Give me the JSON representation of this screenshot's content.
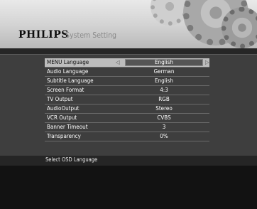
{
  "header": {
    "brand": "PHILIPS",
    "title": "System Setting"
  },
  "menu": {
    "items": [
      {
        "label": "MENU Language",
        "value": "English",
        "selected": true
      },
      {
        "label": "Audio Language",
        "value": "German"
      },
      {
        "label": "Subtitle Language",
        "value": "English"
      },
      {
        "label": "Screen Format",
        "value": "4:3"
      },
      {
        "label": "TV Output",
        "value": "RGB"
      },
      {
        "label": "AudioOutput",
        "value": "Stereo"
      },
      {
        "label": "VCR Output",
        "value": "CVBS"
      },
      {
        "label": "Banner Timeout",
        "value": "3"
      },
      {
        "label": "Transparency",
        "value": "0%"
      }
    ]
  },
  "status": {
    "hint": "Select OSD Language"
  },
  "icons": {
    "left": "arrow-left-icon",
    "right": "arrow-right-icon"
  }
}
